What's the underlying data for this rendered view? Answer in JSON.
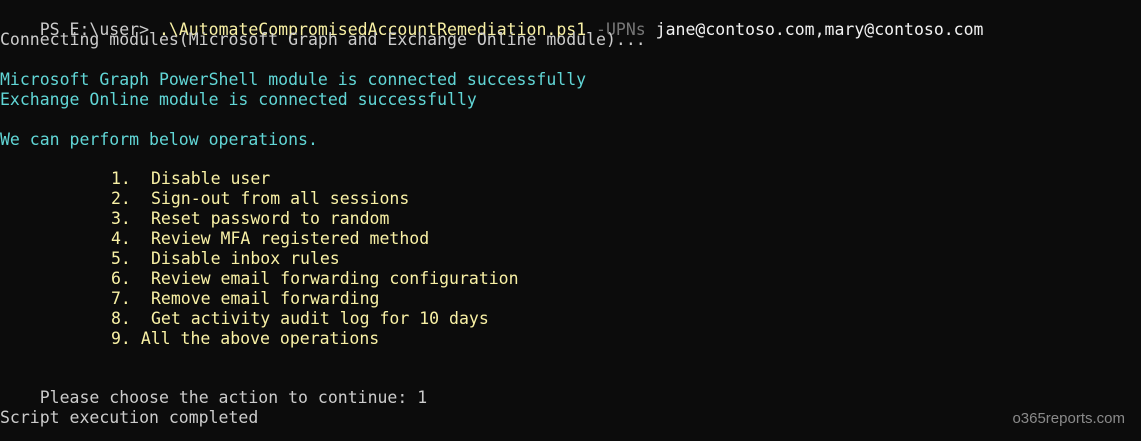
{
  "prompt": {
    "prefix": "PS E:\\user> ",
    "script": ".\\AutomateCompromisedAccountRemediation.ps1",
    "param": " -UPNs ",
    "args": "jane@contoso.com,mary@contoso.com"
  },
  "connecting": "Connecting modules(Microsoft Graph and Exchange Online module)...",
  "status": {
    "graph": "Microsoft Graph PowerShell module is connected successfully",
    "exchange": "Exchange Online module is connected successfully"
  },
  "operations_header": "We can perform below operations.",
  "menu": [
    {
      "num": "1.",
      "label": "Disable user"
    },
    {
      "num": "2.",
      "label": "Sign-out from all sessions"
    },
    {
      "num": "3.",
      "label": "Reset password to random"
    },
    {
      "num": "4.",
      "label": "Review MFA registered method"
    },
    {
      "num": "5.",
      "label": "Disable inbox rules"
    },
    {
      "num": "6.",
      "label": "Review email forwarding configuration"
    },
    {
      "num": "7.",
      "label": "Remove email forwarding"
    },
    {
      "num": "8.",
      "label": "Get activity audit log for 10 days"
    },
    {
      "num": "9.",
      "label": "All the above operations"
    }
  ],
  "choose_prompt": "Please choose the action to continue: ",
  "choice": "1",
  "completed": "Script execution completed",
  "watermark": "o365reports.com",
  "colors": {
    "background": "#0c0c0c",
    "text": "#cccccc",
    "cyan": "#61d6d6",
    "yellow": "#f9f1a5",
    "param_gray": "#767676"
  }
}
